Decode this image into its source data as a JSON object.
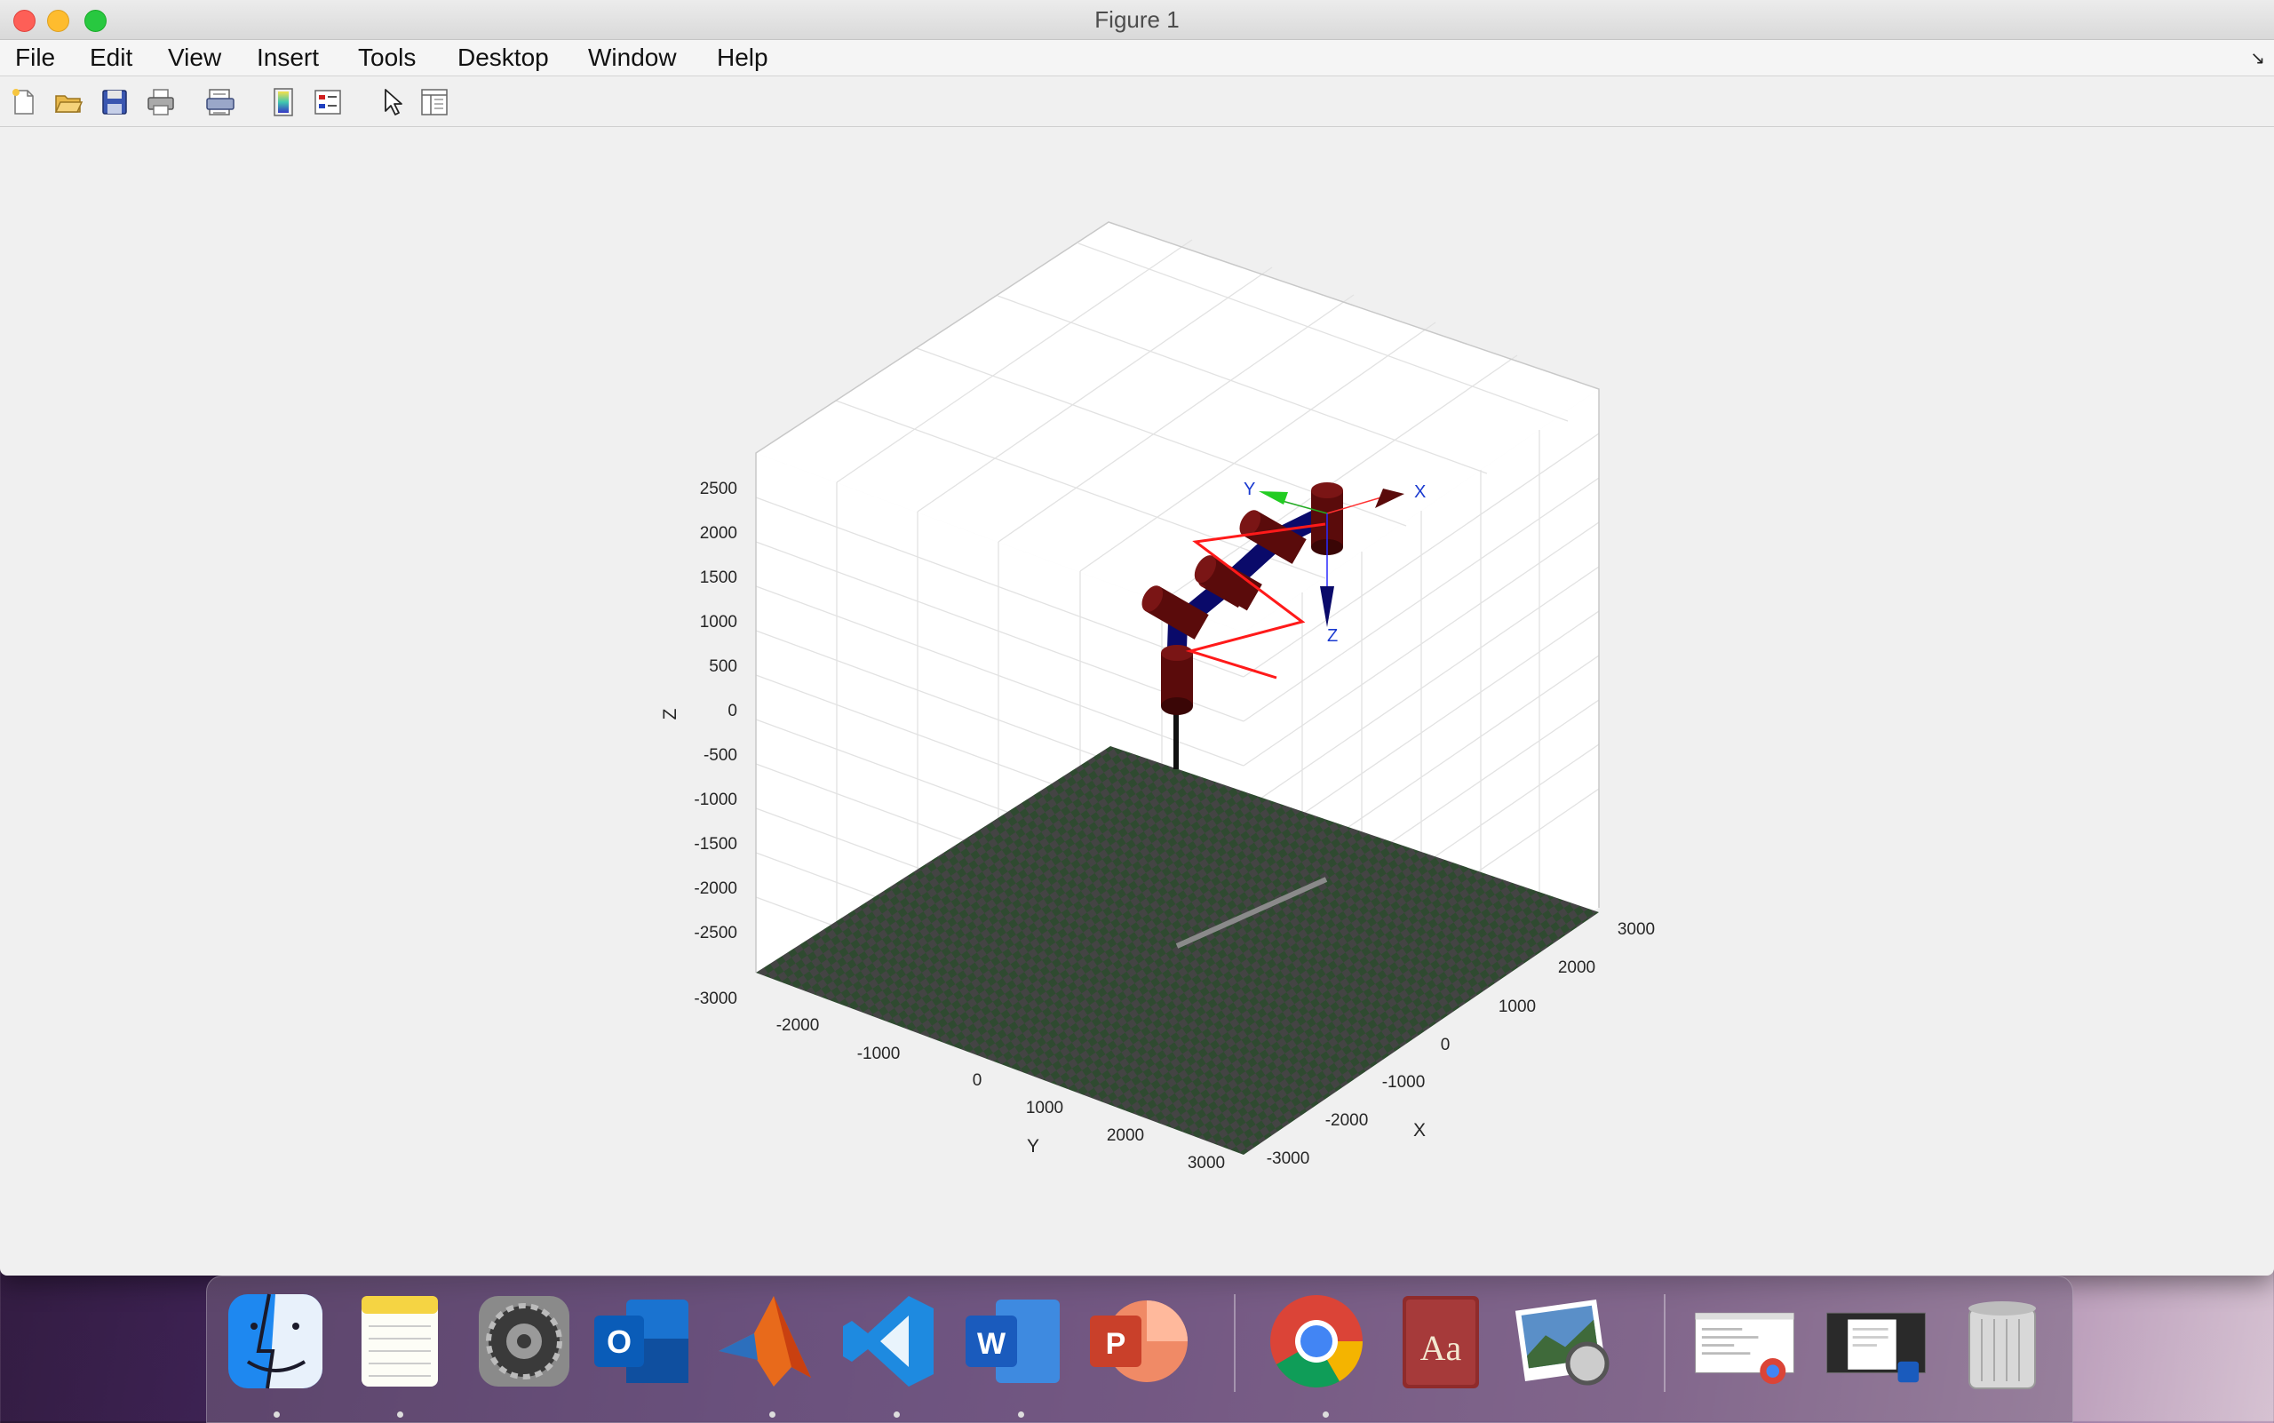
{
  "window": {
    "title": "Figure 1"
  },
  "menu": [
    "File",
    "Edit",
    "View",
    "Insert",
    "Tools",
    "Desktop",
    "Window",
    "Help"
  ],
  "toolbar": [
    "new-figure-icon",
    "open-file-icon",
    "save-icon",
    "print-icon",
    "print-preview-icon",
    "colorbar-icon",
    "legend-icon",
    "pointer-icon",
    "property-inspector-icon"
  ],
  "plot": {
    "z_label": "Z",
    "y_label": "Y",
    "x_label": "X",
    "z_ticks": [
      "2500",
      "2000",
      "1500",
      "1000",
      "500",
      "0",
      "-500",
      "-1000",
      "-1500",
      "-2000",
      "-2500",
      "-3000"
    ],
    "y_ticks": [
      "-2000",
      "-1000",
      "0",
      "1000",
      "2000",
      "3000"
    ],
    "x_ticks": [
      "-3000",
      "-2000",
      "-1000",
      "0",
      "1000",
      "2000",
      "3000"
    ],
    "frame_labels": {
      "x": "X",
      "y": "Y",
      "z": "Z"
    },
    "colors": {
      "floor_a": "#2f4a30",
      "floor_b": "#444444",
      "link": "#0a0a6a",
      "joint": "#5a0b0b",
      "trajectory": "#ff1a1a"
    }
  },
  "dock": {
    "apps": [
      "finder-icon",
      "notes-icon",
      "system-preferences-icon",
      "outlook-icon",
      "matlab-icon",
      "vscode-icon",
      "word-icon",
      "powerpoint-icon",
      "chrome-icon",
      "dictionary-icon",
      "preview-icon",
      "chrome-window-thumbnail",
      "word-window-thumbnail",
      "trash-icon"
    ],
    "dictionary_text": "Aa"
  }
}
